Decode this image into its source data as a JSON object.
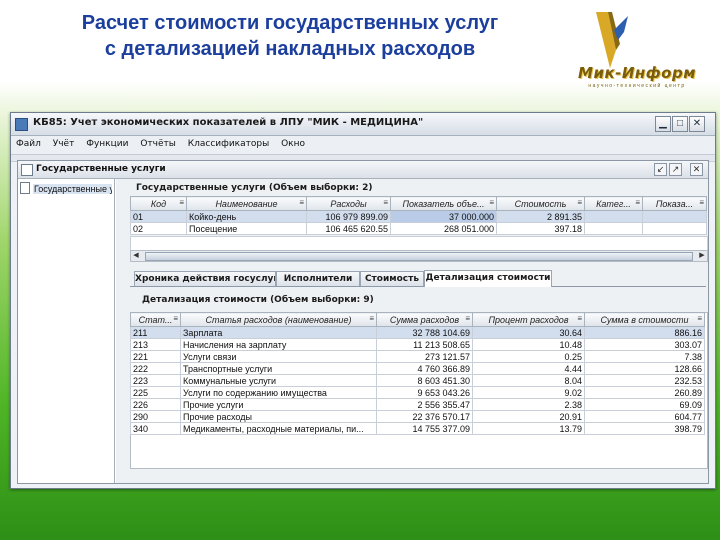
{
  "slide": {
    "title_line1": "Расчет стоимости государственных услуг",
    "title_line2": "с детализацией накладных расходов",
    "logo_text": "Мик-Информ",
    "logo_subtext": "научно-технический центр"
  },
  "window": {
    "title": "КБ85: Учет экономических показателей в ЛПУ \"МИК - МЕДИЦИНА\"",
    "minimize": "▁",
    "maximize": "□",
    "close": "✕"
  },
  "menu": [
    "Файл",
    "Учёт",
    "Функции",
    "Отчёты",
    "Классификаторы",
    "Окно"
  ],
  "frame": {
    "title": "Государственные услуги",
    "tree_item": "Государственные услуги"
  },
  "services": {
    "title": "Государственные услуги (Объем выборки: 2)",
    "columns": [
      "Код",
      "Наименование",
      "Расходы",
      "Показатель объе...",
      "Стоимость",
      "Катег...",
      "Показа..."
    ],
    "rows": [
      [
        "01",
        "Койко-день",
        "106 979 899.09",
        "37 000.000",
        "2 891.35",
        "",
        ""
      ],
      [
        "02",
        "Посещение",
        "106 465 620.55",
        "268 051.000",
        "397.18",
        "",
        ""
      ]
    ]
  },
  "tabs": [
    "Хроника действия госуслуги",
    "Исполнители",
    "Стоимость",
    "Детализация стоимости"
  ],
  "detail": {
    "title": "Детализация стоимости (Объем выборки: 9)",
    "columns": [
      "Стат...",
      "Статья расходов (наименование)",
      "Сумма расходов",
      "Процент расходов",
      "Сумма в стоимости"
    ],
    "rows": [
      [
        "211",
        "Зарплата",
        "32 788 104.69",
        "30.64",
        "886.16"
      ],
      [
        "213",
        "Начисления на зарплату",
        "11 213 508.65",
        "10.48",
        "303.07"
      ],
      [
        "221",
        "Услуги связи",
        "273 121.57",
        "0.25",
        "7.38"
      ],
      [
        "222",
        "Транспортные услуги",
        "4 760 366.89",
        "4.44",
        "128.66"
      ],
      [
        "223",
        "Коммунальные услуги",
        "8 603 451.30",
        "8.04",
        "232.53"
      ],
      [
        "225",
        "Услуги по содержанию имущества",
        "9 653 043.26",
        "9.02",
        "260.89"
      ],
      [
        "226",
        "Прочие услуги",
        "2 556 355.47",
        "2.38",
        "69.09"
      ],
      [
        "290",
        "Прочие расходы",
        "22 376 570.17",
        "20.91",
        "604.77"
      ],
      [
        "340",
        "Медикаменты, расходные материалы, пи...",
        "14 755 377.09",
        "13.79",
        "398.79"
      ]
    ]
  }
}
